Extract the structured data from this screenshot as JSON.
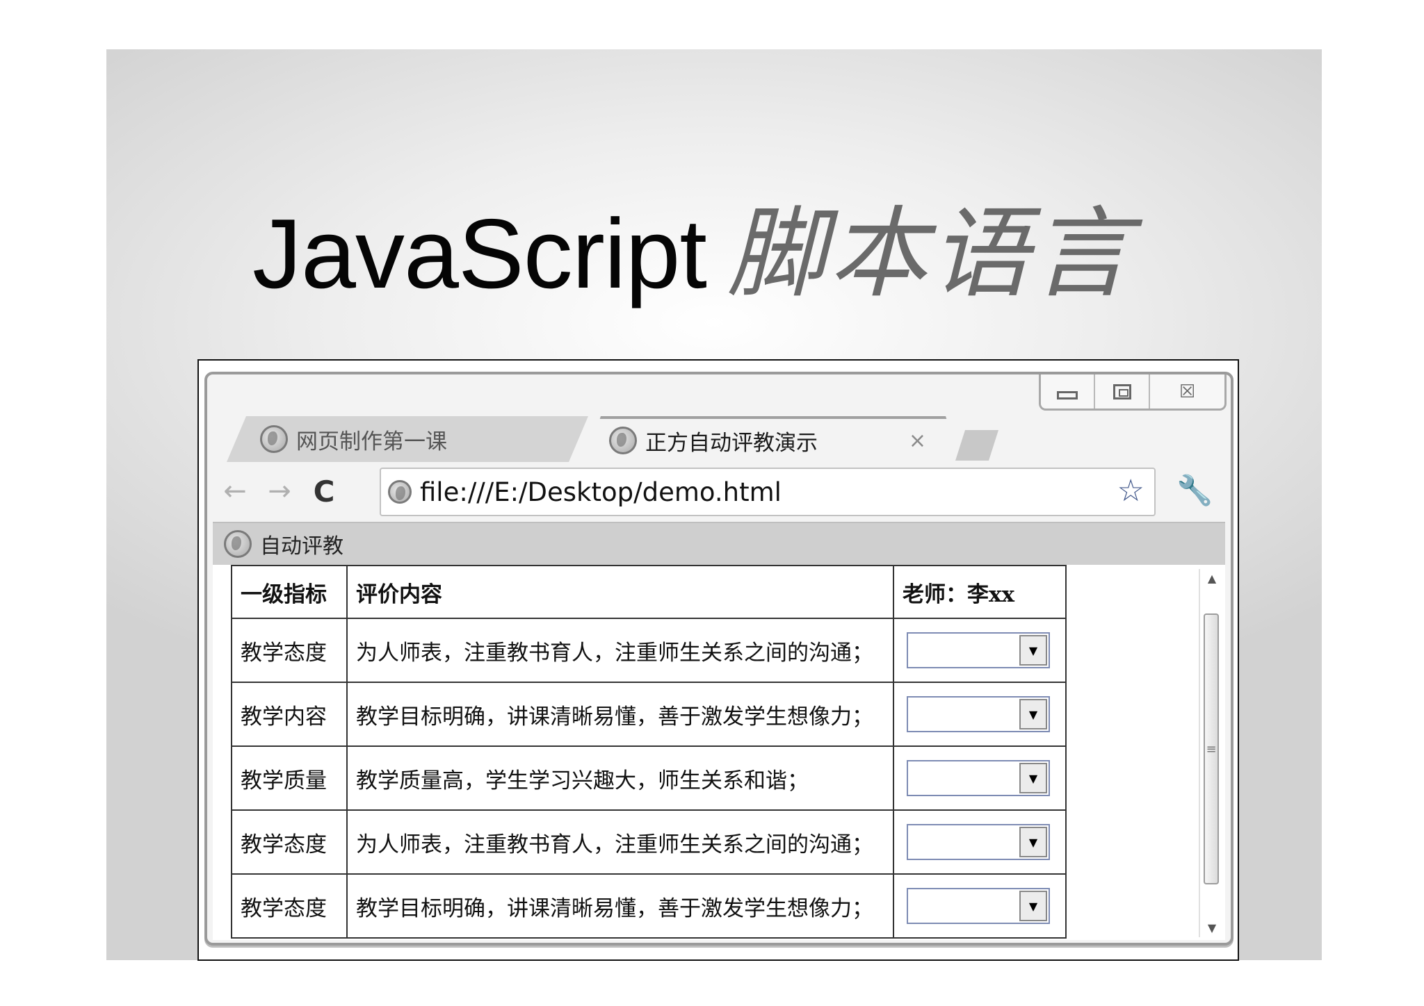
{
  "slide": {
    "title_latin": "JavaScript",
    "title_cjk": "脚本语言"
  },
  "browser": {
    "tabs": [
      {
        "label": "网页制作第一课",
        "active": false
      },
      {
        "label": "正方自动评教演示",
        "active": true
      }
    ],
    "tab_close": "×",
    "nav": {
      "back": "←",
      "forward": "→",
      "reload": "C"
    },
    "url": "file:///E:/Desktop/demo.html",
    "bookmark": {
      "label": "自动评教"
    },
    "window_controls": {
      "close": "☒"
    }
  },
  "table": {
    "headers": [
      "一级指标",
      "评价内容",
      "老师：李xx"
    ],
    "rows": [
      {
        "category": "教学态度",
        "content": "为人师表，注重教书育人，注重师生关系之间的沟通；",
        "selected": ""
      },
      {
        "category": "教学内容",
        "content": "教学目标明确，讲课清晰易懂，善于激发学生想像力；",
        "selected": ""
      },
      {
        "category": "教学质量",
        "content": "教学质量高，学生学习兴趣大，师生关系和谐；",
        "selected": ""
      },
      {
        "category": "教学态度",
        "content": "为人师表，注重教书育人，注重师生关系之间的沟通；",
        "selected": ""
      },
      {
        "category": "教学态度",
        "content": "教学目标明确，讲课清晰易懂，善于激发学生想像力；",
        "selected": ""
      }
    ]
  },
  "icons": {
    "star": "star-icon",
    "wrench": "wrench-icon",
    "globe": "globe-icon"
  },
  "colors": {
    "title_cjk": "#6a6a6a",
    "select_border": "#7d8bb3",
    "star": "#445a8c"
  }
}
